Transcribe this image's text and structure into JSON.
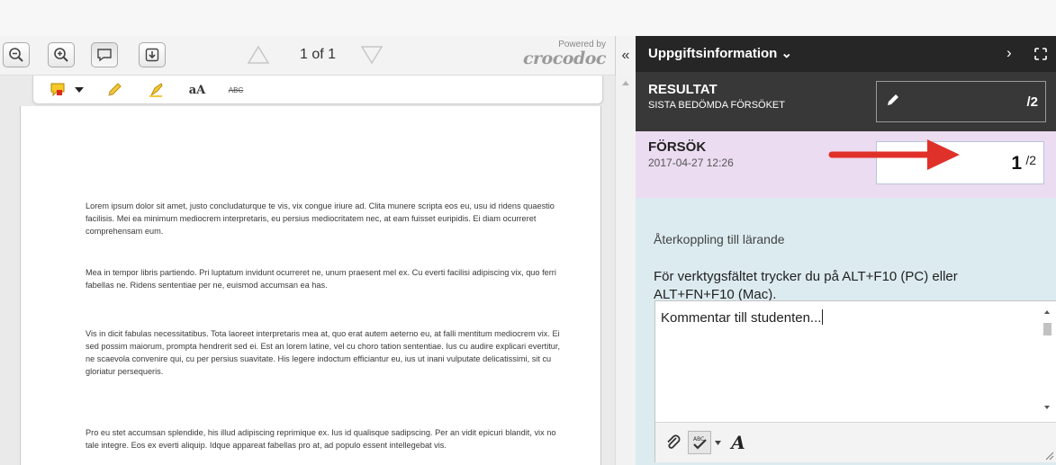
{
  "viewer": {
    "toolbar": {
      "zoom_out_icon": "zoom-out-icon",
      "zoom_in_icon": "zoom-in-icon",
      "comment_icon": "speech-bubble-icon",
      "download_icon": "download-icon",
      "page_info": "1 of 1",
      "powered_by": "Powered by",
      "brand": "crocodoc",
      "collapse_label": "«"
    },
    "annotation_tools": {
      "text_sample": "aA",
      "strike_sample": "ABC"
    },
    "document": {
      "paragraphs": [
        "Lorem ipsum dolor sit amet, justo concludaturque te vis, vix congue iriure ad. Clita munere scripta eos eu, usu id ridens quaestio facilisis. Mei ea minimum mediocrem interpretaris, eu persius mediocritatem nec, at eam fuisset euripidis. Ei diam ocurreret comprehensam eum.",
        "Mea in tempor libris partiendo. Pri luptatum invidunt ocurreret ne, unum praesent mel ex. Cu everti facilisi adipiscing vix, quo ferri fabellas ne. Ridens sententiae per ne, euismod accumsan ea has.",
        "Vis in dicit fabulas necessitatibus. Tota laoreet interpretaris mea at, quo erat autem aeterno eu, at falli mentitum mediocrem vix. Ei sed possim maiorum, prompta hendrerit sed ei. Est an lorem latine, vel cu choro tation sententiae. Ius cu audire explicari evertitur, ne scaevola convenire qui, cu per persius suavitate. His legere indoctum efficiantur eu, ius ut inani vulputate delicatissimi, sit cu gloriatur persequeris.",
        "Pro eu stet accumsan splendide, his illud adipiscing reprimique ex. Ius id qualisque sadipscing. Per an vidit epicuri blandit, vix no tale integre. Eos ex everti aliquip. Idque appareat fabellas pro at, ad populo essent intellegebat vis."
      ]
    }
  },
  "panel": {
    "header": {
      "title": "Uppgiftsinformation",
      "chevron": "⌄",
      "next": "›"
    },
    "result": {
      "title": "RESULTAT",
      "subtitle": "SISTA BEDÖMDA FÖRSÖKET",
      "denominator": "/2"
    },
    "attempt": {
      "title": "FÖRSÖK",
      "date": "2017-04-27 12:26",
      "score": "1",
      "denominator": "/2"
    },
    "feedback": {
      "label": "Återkoppling till lärande",
      "hint": "För verktygsfältet trycker du på ALT+F10 (PC) eller ALT+FN+F10 (Mac).",
      "value": "Kommentar till studenten..."
    }
  },
  "colors": {
    "panel_header": "#262626",
    "result_bg": "#383838",
    "attempt_bg": "#ecdcf1",
    "feedback_bg": "#dcebf0",
    "arrow": "#e0302a"
  }
}
